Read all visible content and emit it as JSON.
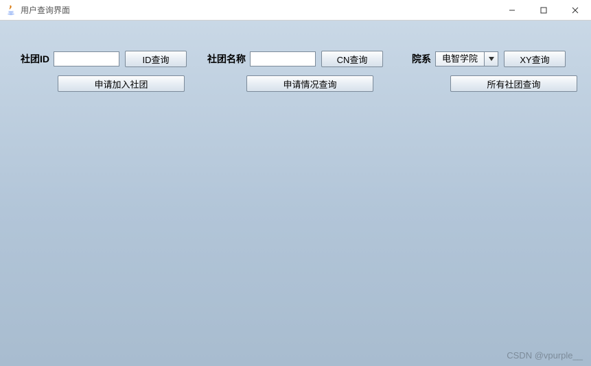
{
  "window": {
    "title": "用户查询界面"
  },
  "row1": {
    "club_id_label": "社团ID",
    "club_id_value": "",
    "id_query_btn": "ID查询",
    "club_name_label": "社团名称",
    "club_name_value": "",
    "cn_query_btn": "CN查询",
    "dept_label": "院系",
    "dept_selected": "电智学院",
    "xy_query_btn": "XY查询"
  },
  "row2": {
    "apply_join_btn": "申请加入社团",
    "apply_status_btn": "申请情况查询",
    "all_clubs_btn": "所有社团查询"
  },
  "watermark": "CSDN @vpurple__"
}
